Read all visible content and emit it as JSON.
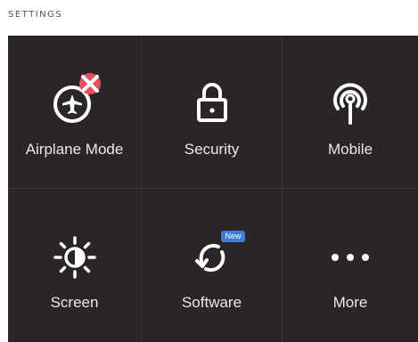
{
  "header": {
    "title": "SETTINGS"
  },
  "tiles": [
    {
      "label": "Airplane Mode",
      "icon": "airplane-icon",
      "badge": "error"
    },
    {
      "label": "Security",
      "icon": "lock-icon"
    },
    {
      "label": "Mobile",
      "icon": "antenna-icon"
    },
    {
      "label": "Screen",
      "icon": "brightness-icon"
    },
    {
      "label": "Software",
      "icon": "refresh-icon",
      "badge_text": "New"
    },
    {
      "label": "More",
      "icon": "more-dots-icon"
    }
  ],
  "colors": {
    "tile_background": "#2a2627",
    "text": "#ece8e8",
    "error_badge": "#e4505c",
    "new_badge": "#3b7dde"
  }
}
